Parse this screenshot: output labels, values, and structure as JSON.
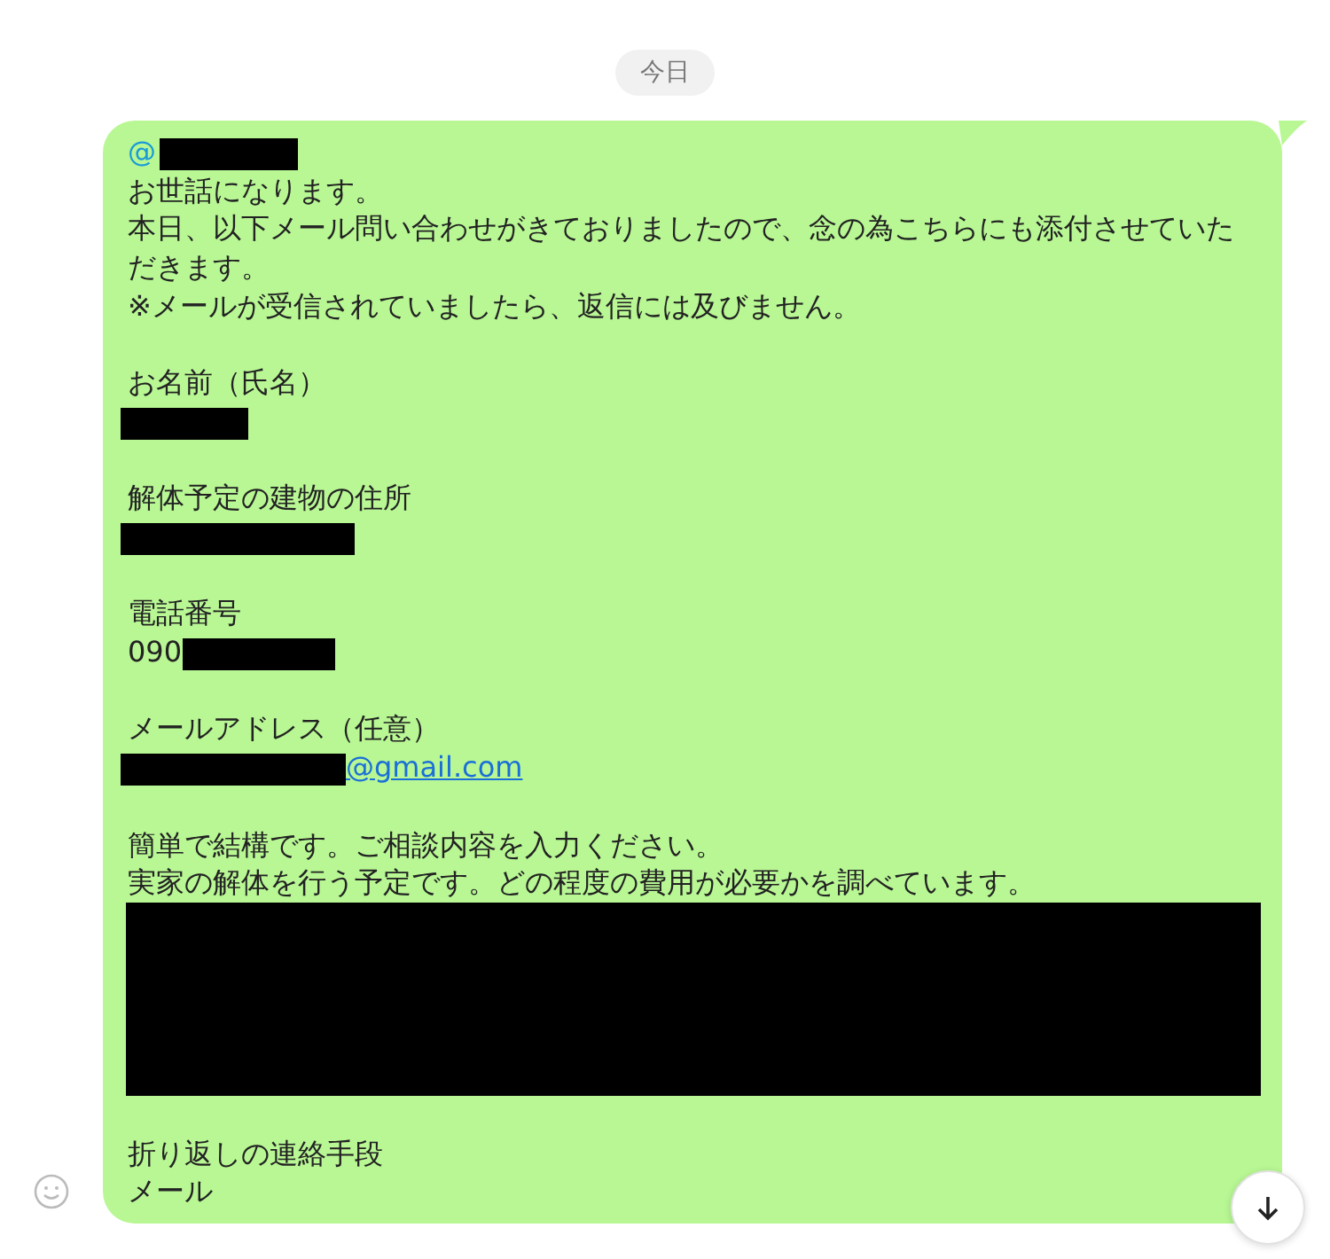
{
  "date_label": "今日",
  "message": {
    "lines": [
      {
        "kind": "mention",
        "text": "@"
      },
      {
        "kind": "text",
        "text": "お世話になります。"
      },
      {
        "kind": "text",
        "text": "本日、以下メール問い合わせがきておりましたので、念の為こちらにも添付させていただきます。"
      },
      {
        "kind": "text",
        "text": "※メールが受信されていましたら、返信には及びません。"
      },
      {
        "kind": "gap"
      },
      {
        "kind": "text",
        "text": "お名前（氏名）"
      },
      {
        "kind": "redacted"
      },
      {
        "kind": "gap"
      },
      {
        "kind": "text",
        "text": "解体予定の建物の住所"
      },
      {
        "kind": "redacted"
      },
      {
        "kind": "gap"
      },
      {
        "kind": "text",
        "text": "電話番号"
      },
      {
        "kind": "redacted",
        "prefix": "090"
      },
      {
        "kind": "gap"
      },
      {
        "kind": "text",
        "text": "メールアドレス（任意）"
      },
      {
        "kind": "redacted",
        "link": "@gmail.com"
      },
      {
        "kind": "gap"
      },
      {
        "kind": "text",
        "text": "簡単で結構です。ご相談内容を入力ください。"
      },
      {
        "kind": "text",
        "text": "実家の解体を行う予定です。どの程度の費用が必要かを調べています。"
      },
      {
        "kind": "redacted_block"
      },
      {
        "kind": "gap"
      },
      {
        "kind": "text",
        "text": "折り返しの連絡手段"
      },
      {
        "kind": "text",
        "text": "メール"
      }
    ]
  }
}
